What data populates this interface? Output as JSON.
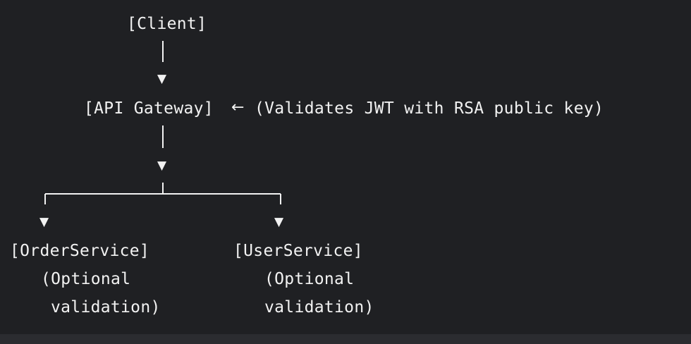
{
  "diagram": {
    "client_label": "[Client]",
    "gateway_label": "[API Gateway]",
    "gateway_arrow": "←",
    "gateway_note": "(Validates JWT with RSA public key)",
    "order_service": {
      "label": "[OrderService]",
      "note_line1": "(Optional",
      "note_line2": "validation)"
    },
    "user_service": {
      "label": "[UserService]",
      "note_line1": "(Optional",
      "note_line2": "validation)"
    },
    "arrow_glyph": "▼"
  },
  "colors": {
    "background": "#1f2023",
    "text": "#f2f2f2",
    "bottom_strip": "#2b2c30"
  },
  "icons": {
    "down_arrow": "down-triangle-icon",
    "left_arrow": "left-arrow-icon"
  }
}
